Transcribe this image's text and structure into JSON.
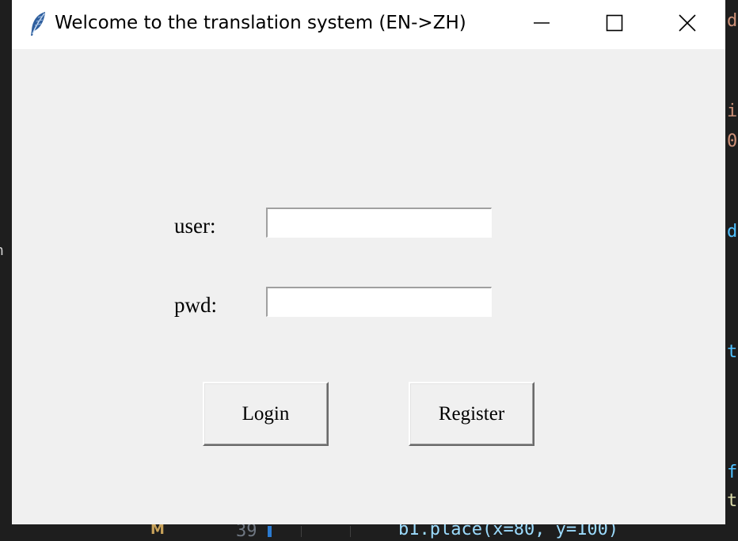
{
  "window": {
    "title": "Welcome to the translation system (EN->ZH)",
    "icon": "feather-icon",
    "controls": {
      "minimize": "minimize-icon",
      "maximize": "maximize-icon",
      "close": "close-icon"
    }
  },
  "form": {
    "user_label": "user:",
    "user_value": "",
    "pwd_label": "pwd:",
    "pwd_value": "",
    "login_label": "Login",
    "register_label": "Register"
  },
  "background_editor": {
    "right_fragments": [
      {
        "text": "d",
        "color": "#ce9178"
      },
      {
        "text": "i",
        "color": "#ce9178"
      },
      {
        "text": "0",
        "color": "#ce9178"
      },
      {
        "text": "d",
        "color": "#4fc1ff"
      },
      {
        "text": "t",
        "color": "#4fc1ff"
      },
      {
        "text": "f",
        "color": "#4fc1ff"
      },
      {
        "text": "t",
        "color": "#dcdcaa"
      }
    ],
    "left_fragment": "n",
    "gutter_marker": "M",
    "line_number": "39",
    "code_line": "b1.place(x=80, y=100)"
  },
  "colors": {
    "window_bg": "#f0f0f0",
    "titlebar_bg": "#ffffff",
    "editor_bg": "#1e1e1e"
  }
}
